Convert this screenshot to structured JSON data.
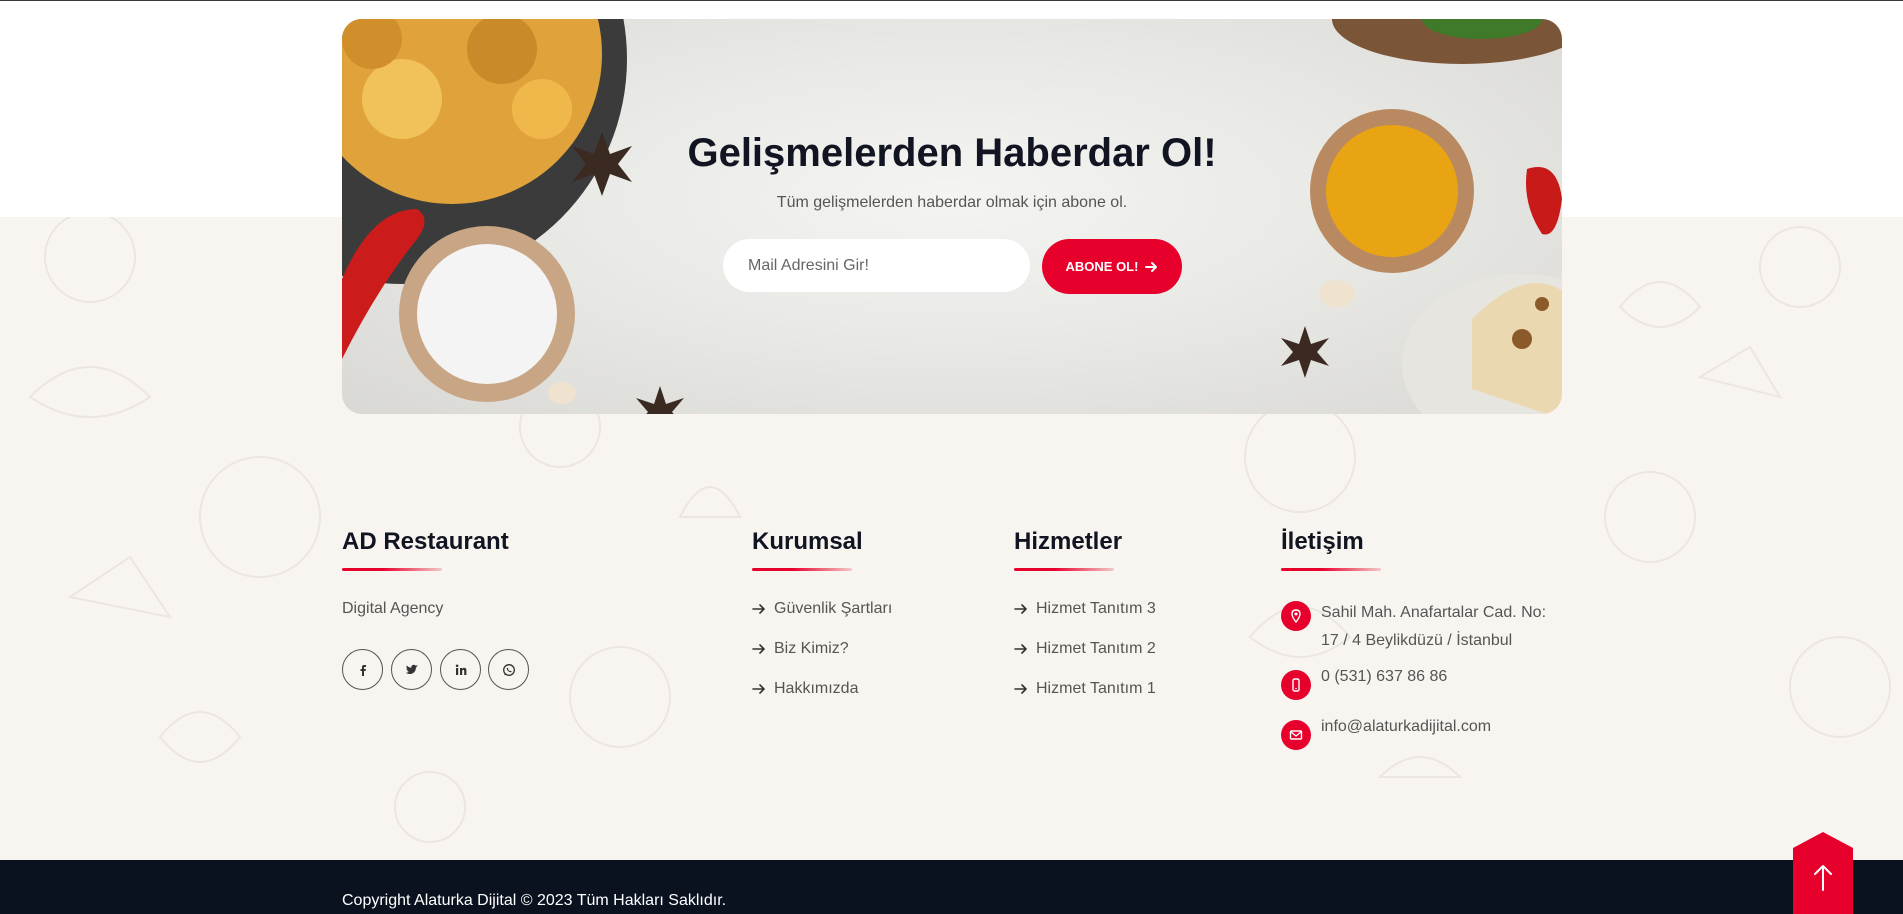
{
  "newsletter": {
    "title": "Gelişmelerden Haberdar Ol!",
    "subtitle": "Tüm gelişmelerden haberdar olmak için abone ol.",
    "input_placeholder": "Mail Adresini Gir!",
    "button_label": "ABONE OL!"
  },
  "brand": {
    "title": "AD Restaurant",
    "tagline": "Digital Agency",
    "socials": [
      "facebook-icon",
      "twitter-icon",
      "linkedin-icon",
      "whatsapp-icon"
    ]
  },
  "kurumsal": {
    "title": "Kurumsal",
    "links": [
      "Güvenlik Şartları",
      "Biz Kimiz?",
      "Hakkımızda"
    ]
  },
  "hizmetler": {
    "title": "Hizmetler",
    "links": [
      "Hizmet Tanıtım 3",
      "Hizmet Tanıtım 2",
      "Hizmet Tanıtım 1"
    ]
  },
  "iletisim": {
    "title": "İletişim",
    "address_line1": "Sahil Mah. Anafartalar Cad. No:",
    "address_line2": "17 / 4 Beylikdüzü / İstanbul",
    "phone": "0 (531) 637 86 86",
    "email": "info@alaturkadijital.com"
  },
  "footer": {
    "copyright": "Copyright Alaturka Dijital © 2023 Tüm Hakları Saklıdır."
  },
  "colors": {
    "accent": "#e8002d",
    "dark": "#0a121f",
    "background": "#f8f5f0"
  }
}
